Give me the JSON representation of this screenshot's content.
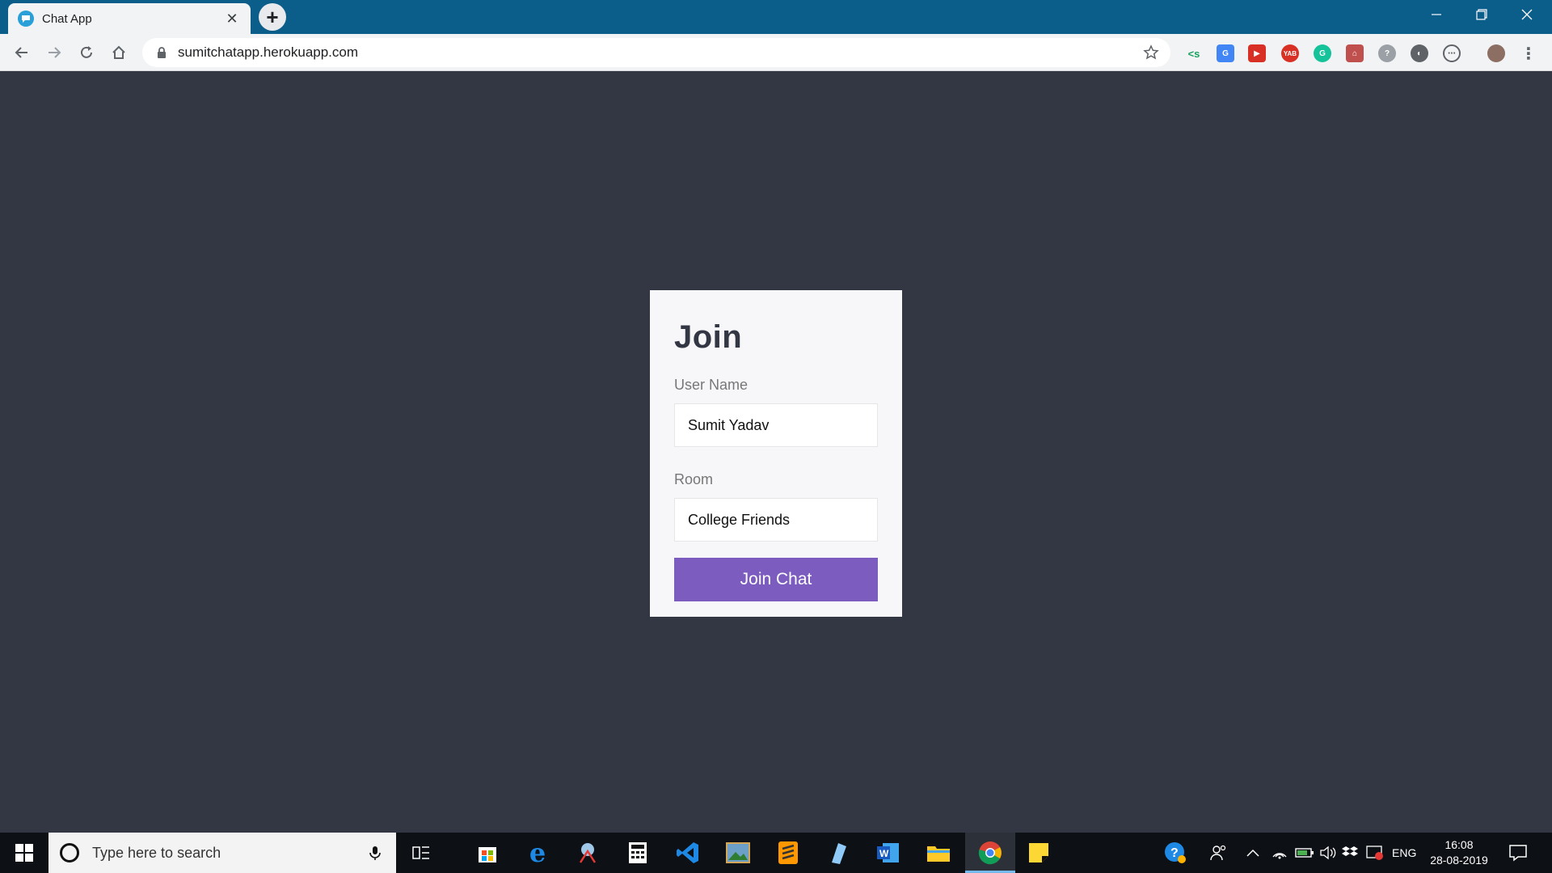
{
  "browser": {
    "tab_title": "Chat App",
    "url": "sumitchatapp.herokuapp.com"
  },
  "join_form": {
    "title": "Join",
    "username_label": "User Name",
    "username_value": "Sumit Yadav",
    "room_label": "Room",
    "room_value": "College Friends",
    "button_label": "Join Chat"
  },
  "taskbar": {
    "search_placeholder": "Type here to search",
    "language": "ENG",
    "time": "16:08",
    "date": "28-08-2019"
  },
  "colors": {
    "page_background": "#333744",
    "card_background": "#f7f7fa",
    "button": "#7c5cbf",
    "title_bar": "#0b5d8a"
  }
}
